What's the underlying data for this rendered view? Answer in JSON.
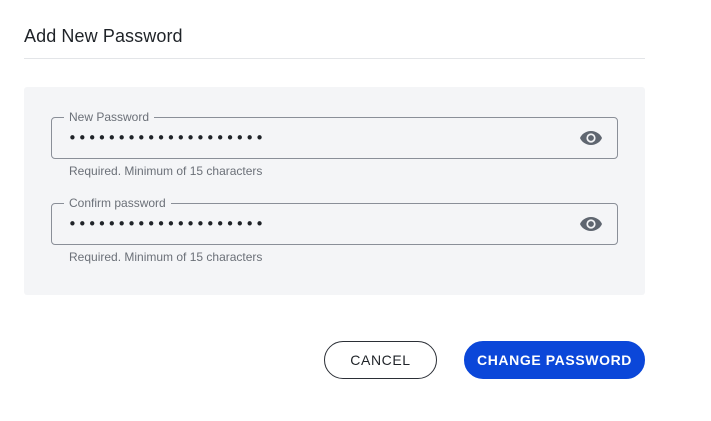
{
  "dialog": {
    "title": "Add New Password"
  },
  "fields": {
    "new_password": {
      "label": "New Password",
      "value": "••••••••••••••••••••",
      "helper": "Required. Minimum of 15 characters",
      "toggle_icon": "eye-icon"
    },
    "confirm_password": {
      "label": "Confirm password",
      "value": "••••••••••••••••••••",
      "helper": "Required. Minimum of 15 characters",
      "toggle_icon": "eye-icon"
    }
  },
  "actions": {
    "cancel_label": "CANCEL",
    "change_label": "CHANGE PASSWORD"
  },
  "colors": {
    "primary": "#0b47d9",
    "panel": "#f4f5f7"
  }
}
